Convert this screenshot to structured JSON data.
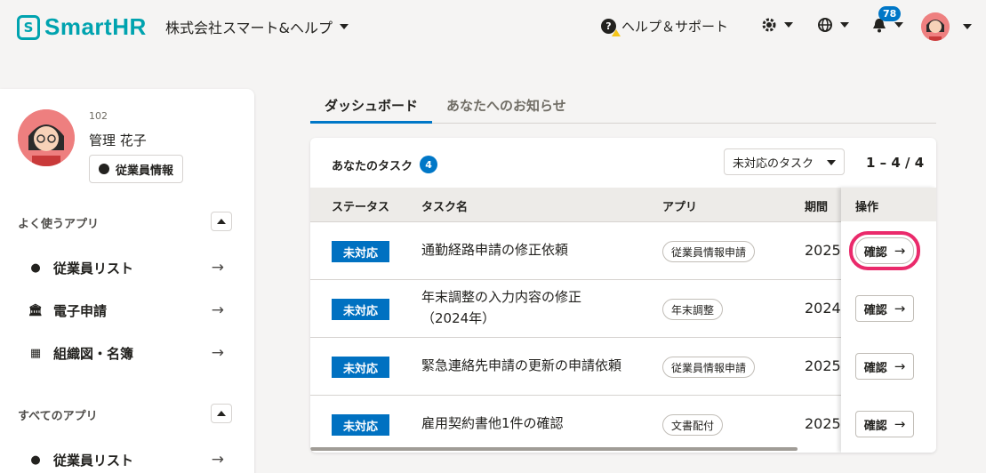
{
  "header": {
    "logo_text": "SmartHR",
    "company": "株式会社スマート&ヘルプ",
    "help_label": "ヘルプ＆サポート",
    "notification_count": "78"
  },
  "sidebar": {
    "employee_no": "102",
    "employee_name": "管理 花子",
    "employee_info_button": "従業員情報",
    "favorites_title": "よく使うアプリ",
    "favorites": [
      {
        "label": "従業員リスト",
        "icon": "person-icon"
      },
      {
        "label": "電子申請",
        "icon": "bank-icon"
      },
      {
        "label": "組織図・名簿",
        "icon": "org-chart-icon"
      }
    ],
    "all_apps_title": "すべてのアプリ",
    "all_apps": [
      {
        "label": "従業員リスト",
        "icon": "person-icon"
      }
    ]
  },
  "tabs": [
    {
      "label": "ダッシュボード",
      "active": true
    },
    {
      "label": "あなたへのお知らせ",
      "active": false
    }
  ],
  "tasks": {
    "title": "あなたのタスク",
    "count": "4",
    "filter_value": "未対応のタスク",
    "pagination": "1 – 4 / 4",
    "columns": [
      "ステータス",
      "タスク名",
      "アプリ",
      "期間",
      "操作"
    ],
    "rows": [
      {
        "status": "未対応",
        "task_line1": "通勤経路申請の修正依頼",
        "task_line2": "",
        "app": "従業員情報申請",
        "period": "2025/",
        "action": "確認"
      },
      {
        "status": "未対応",
        "task_line1": "年末調整の入力内容の修正",
        "task_line2": "（2024年）",
        "app": "年末調整",
        "period": "2024/",
        "action": "確認"
      },
      {
        "status": "未対応",
        "task_line1": "緊急連絡先申請の更新の申請依頼",
        "task_line2": "",
        "app": "従業員情報申請",
        "period": "2025/",
        "action": "確認"
      },
      {
        "status": "未対応",
        "task_line1": "雇用契約書他1件の確認",
        "task_line2": "",
        "app": "文書配付",
        "period": "2025/",
        "action": "確認"
      }
    ]
  },
  "colors": {
    "brand": "#00a3af",
    "accent": "#0077c7",
    "highlight": "#ea2a6b"
  }
}
